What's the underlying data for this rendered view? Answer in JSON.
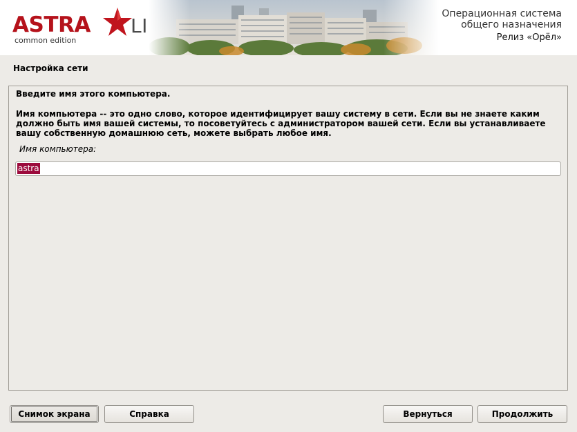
{
  "header": {
    "logo_astra": "ASTRA",
    "logo_linux": "LINUX",
    "logo_edition": "common edition",
    "os_line1": "Операционная система",
    "os_line2": "общего назначения",
    "os_release": "Релиз «Орёл»"
  },
  "section_title": "Настройка сети",
  "prompt": {
    "title": "Введите имя этого компьютера.",
    "description": "Имя компьютера -- это одно слово, которое идентифицирует вашу систему в сети. Если вы не знаете каким должно быть имя вашей системы, то посоветуйтесь с администратором вашей сети. Если вы устанавливаете вашу собственную домашнюю сеть, можете выбрать любое имя.",
    "field_label": "Имя компьютера:",
    "field_value": "astra"
  },
  "buttons": {
    "screenshot": "Снимок экрана",
    "help": "Справка",
    "back": "Вернуться",
    "continue": "Продолжить"
  },
  "colors": {
    "brand_red": "#b5121b",
    "selection": "#9c0a3c",
    "background": "#edebe7"
  },
  "icons": {
    "logo_star": "red-star-icon"
  }
}
